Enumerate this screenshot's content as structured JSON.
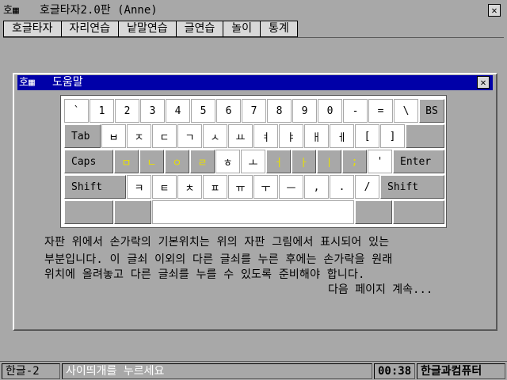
{
  "app": {
    "icon": "호▦",
    "title": "호글타자2.0판 (Anne)",
    "close_glyph": "✕"
  },
  "menu": {
    "items": [
      {
        "label": "호글타자"
      },
      {
        "label": "자리연습"
      },
      {
        "label": "낱말연습"
      },
      {
        "label": "글연습"
      },
      {
        "label": "놀이"
      },
      {
        "label": "통계"
      }
    ]
  },
  "dialog": {
    "icon": "호▦",
    "title": "도움말",
    "close_glyph": "✕"
  },
  "keyboard": {
    "row1": [
      "`",
      "1",
      "2",
      "3",
      "4",
      "5",
      "6",
      "7",
      "8",
      "9",
      "0",
      "-",
      "=",
      "\\",
      "BS"
    ],
    "row2": [
      "Tab",
      "ㅂ",
      "ㅈ",
      "ㄷ",
      "ㄱ",
      "ㅅ",
      "ㅛ",
      "ㅕ",
      "ㅑ",
      "ㅐ",
      "ㅔ",
      "[",
      "]"
    ],
    "row3": [
      "Caps",
      "ㅁ",
      "ㄴ",
      "ㅇ",
      "ㄹ",
      "ㅎ",
      "ㅗ",
      "ㅓ",
      "ㅏ",
      "ㅣ",
      ";",
      "'",
      "Enter"
    ],
    "row4": [
      "Shift",
      "ㅋ",
      "ㅌ",
      "ㅊ",
      "ㅍ",
      "ㅠ",
      "ㅜ",
      "ㅡ",
      ",",
      ".",
      "/",
      "Shift"
    ],
    "home_key_color": "#e8e000"
  },
  "help": {
    "line1": "자판 위에서 손가락의 기본위치는 위의 자판 그림에서 표시되어 있는",
    "line2": "부분입니다. 이 글쇠 이외의 다른 글쇠를 누른 후에는 손가락을 원래",
    "line3": "위치에 올려놓고 다른 글쇠를 누를 수 있도록 준비해야 합니다.",
    "next": "다음 페이지 계속..."
  },
  "status": {
    "mode": "한글-2",
    "message": "사이띄개를 누르세요",
    "time": "00:38",
    "brand": "한글과컴퓨터"
  }
}
